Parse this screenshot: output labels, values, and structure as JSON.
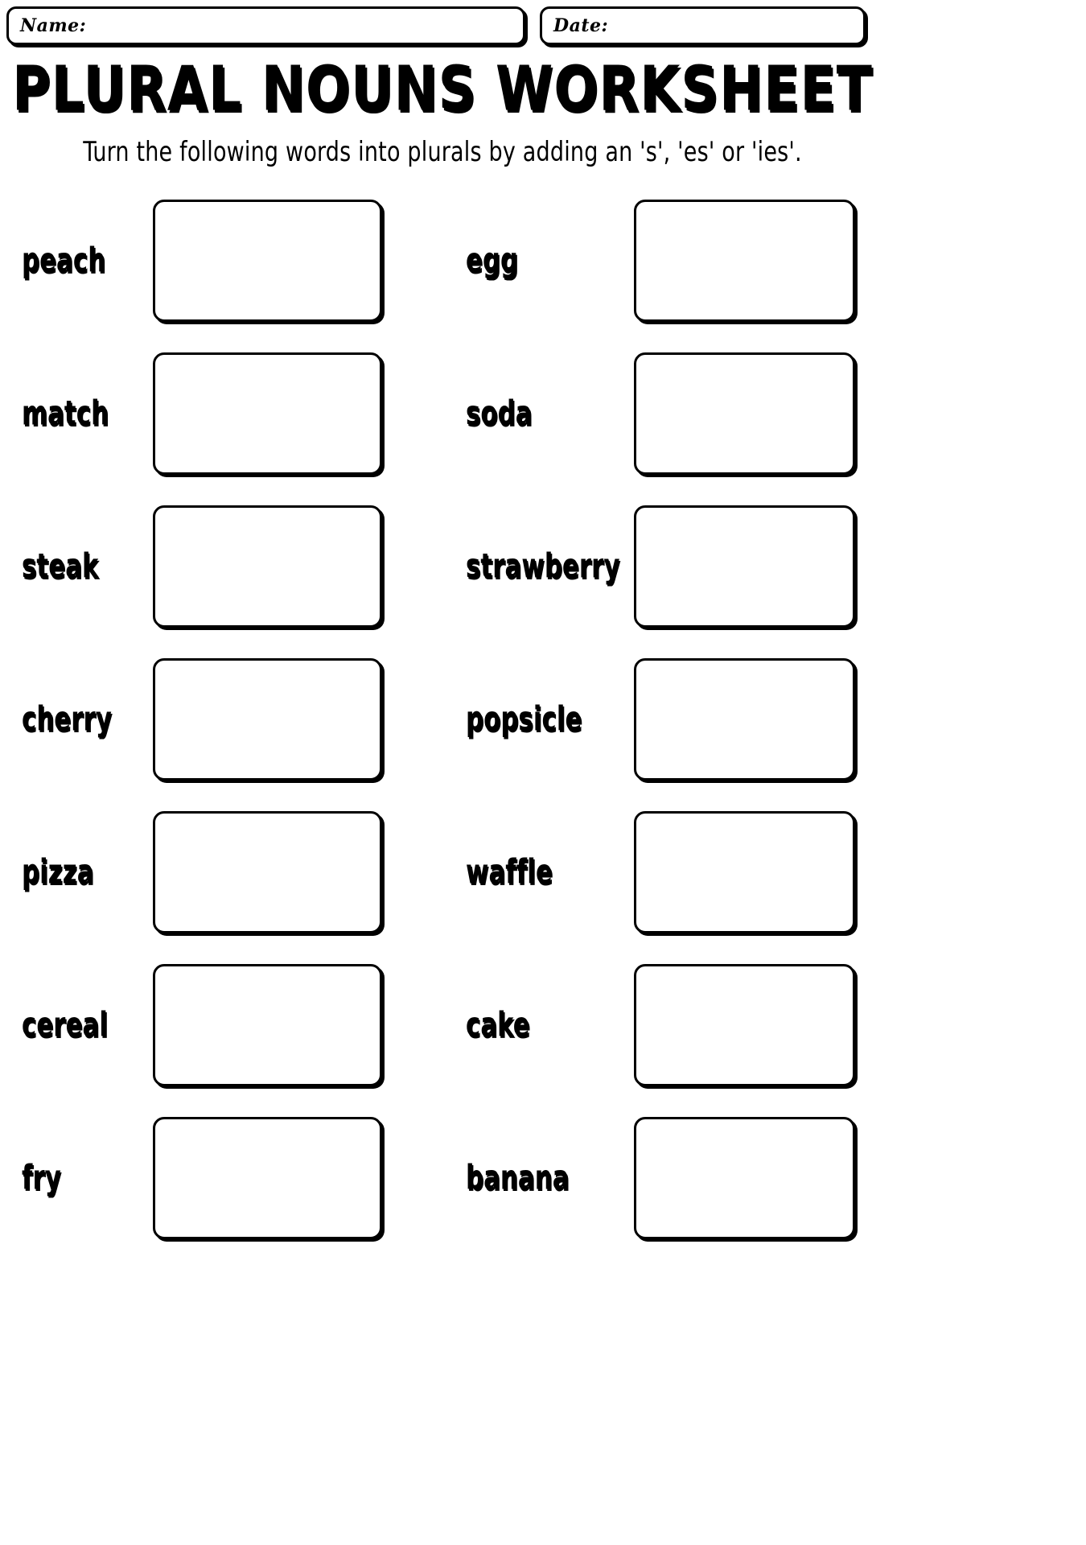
{
  "header": {
    "name_label": "Name:",
    "date_label": "Date:",
    "name_value": "",
    "date_value": ""
  },
  "title": "PLURAL NOUNS WORKSHEET",
  "subtitle": "Turn the following words into plurals by adding an 's', 'es' or 'ies'.",
  "exercises": [
    {
      "left_word": "peach",
      "left_answer": "",
      "right_word": "egg",
      "right_answer": ""
    },
    {
      "left_word": "match",
      "left_answer": "",
      "right_word": "soda",
      "right_answer": ""
    },
    {
      "left_word": "steak",
      "left_answer": "",
      "right_word": "strawberry",
      "right_answer": ""
    },
    {
      "left_word": "cherry",
      "left_answer": "",
      "right_word": "popsicle",
      "right_answer": ""
    },
    {
      "left_word": "pizza",
      "left_answer": "",
      "right_word": "waffle",
      "right_answer": ""
    },
    {
      "left_word": "cereal",
      "left_answer": "",
      "right_word": "cake",
      "right_answer": ""
    },
    {
      "left_word": "fry",
      "left_answer": "",
      "right_word": "banana",
      "right_answer": ""
    }
  ],
  "colors": {
    "ink": "#000000",
    "paper": "#ffffff"
  }
}
